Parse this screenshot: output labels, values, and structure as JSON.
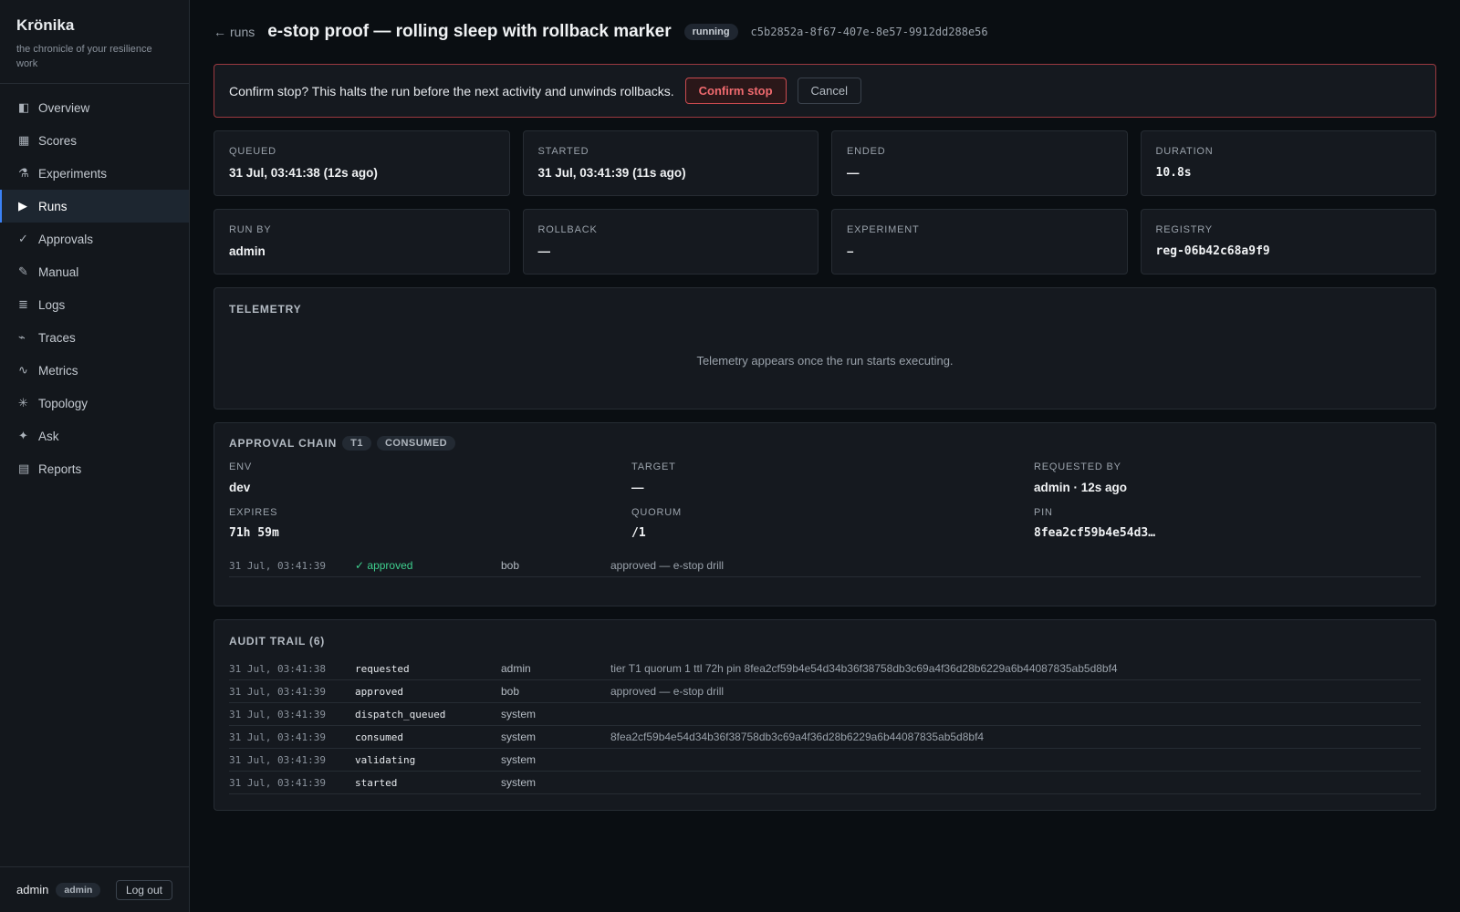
{
  "sidebar": {
    "brand": "Krönika",
    "tagline": "the chronicle of your resilience work",
    "items": [
      {
        "label": "Overview",
        "icon": "◧",
        "icon_name": "overview-icon"
      },
      {
        "label": "Scores",
        "icon": "▦",
        "icon_name": "scores-icon"
      },
      {
        "label": "Experiments",
        "icon": "⚗",
        "icon_name": "flask-icon"
      },
      {
        "label": "Runs",
        "icon": "▶",
        "icon_name": "play-icon"
      },
      {
        "label": "Approvals",
        "icon": "✓",
        "icon_name": "check-icon"
      },
      {
        "label": "Manual",
        "icon": "✎",
        "icon_name": "pencil-icon"
      },
      {
        "label": "Logs",
        "icon": "≣",
        "icon_name": "logs-icon"
      },
      {
        "label": "Traces",
        "icon": "⌁",
        "icon_name": "traces-icon"
      },
      {
        "label": "Metrics",
        "icon": "∿",
        "icon_name": "metrics-icon"
      },
      {
        "label": "Topology",
        "icon": "✳",
        "icon_name": "topology-icon"
      },
      {
        "label": "Ask",
        "icon": "✦",
        "icon_name": "sparkle-icon"
      },
      {
        "label": "Reports",
        "icon": "▤",
        "icon_name": "reports-icon"
      }
    ],
    "user": "admin",
    "role": "admin",
    "logout_label": "Log out"
  },
  "header": {
    "back_arrow": "←",
    "back_label": "runs",
    "title": "e-stop proof — rolling sleep with rollback marker",
    "status": "running",
    "run_id": "c5b2852a-8f67-407e-8e57-9912dd288e56"
  },
  "confirm": {
    "text": "Confirm stop? This halts the run before the next activity and unwinds rollbacks.",
    "confirm_label": "Confirm stop",
    "cancel_label": "Cancel"
  },
  "cards_row1": [
    {
      "label": "QUEUED",
      "value": "31 Jul, 03:41:38 (12s ago)"
    },
    {
      "label": "STARTED",
      "value": "31 Jul, 03:41:39 (11s ago)"
    },
    {
      "label": "ENDED",
      "value": "—"
    },
    {
      "label": "DURATION",
      "value": "10.8s"
    }
  ],
  "cards_row2": [
    {
      "label": "RUN BY",
      "value": "admin"
    },
    {
      "label": "ROLLBACK",
      "value": "—"
    },
    {
      "label": "EXPERIMENT",
      "value": "–"
    },
    {
      "label": "REGISTRY",
      "value": "reg-06b42c68a9f9"
    }
  ],
  "telemetry": {
    "title": "TELEMETRY",
    "empty_text": "Telemetry appears once the run starts executing."
  },
  "approval": {
    "title": "APPROVAL CHAIN",
    "tier": "T1",
    "state": "CONSUMED",
    "fields": [
      {
        "label": "ENV",
        "value": "dev"
      },
      {
        "label": "TARGET",
        "value": "—"
      },
      {
        "label": "REQUESTED BY",
        "value": "admin · 12s ago"
      },
      {
        "label": "EXPIRES",
        "value": "71h 59m"
      },
      {
        "label": "QUORUM",
        "value": "/1"
      },
      {
        "label": "PIN",
        "value": "8fea2cf59b4e54d3…"
      }
    ],
    "row": {
      "time": "31 Jul, 03:41:39",
      "status": "✓ approved",
      "actor": "bob",
      "note": "approved — e-stop drill"
    }
  },
  "audit": {
    "title": "AUDIT TRAIL (6)",
    "rows": [
      {
        "time": "31 Jul, 03:41:38",
        "event": "requested",
        "actor": "admin",
        "detail": "tier T1 quorum 1 ttl 72h pin 8fea2cf59b4e54d34b36f38758db3c69a4f36d28b6229a6b44087835ab5d8bf4"
      },
      {
        "time": "31 Jul, 03:41:39",
        "event": "approved",
        "actor": "bob",
        "detail": "approved — e-stop drill"
      },
      {
        "time": "31 Jul, 03:41:39",
        "event": "dispatch_queued",
        "actor": "system",
        "detail": ""
      },
      {
        "time": "31 Jul, 03:41:39",
        "event": "consumed",
        "actor": "system",
        "detail": "8fea2cf59b4e54d34b36f38758db3c69a4f36d28b6229a6b44087835ab5d8bf4"
      },
      {
        "time": "31 Jul, 03:41:39",
        "event": "validating",
        "actor": "system",
        "detail": ""
      },
      {
        "time": "31 Jul, 03:41:39",
        "event": "started",
        "actor": "system",
        "detail": ""
      }
    ]
  },
  "colors": {
    "accent": "#3b82f6",
    "danger": "#f06a6f",
    "success": "#3ecf8e",
    "background": "#0a0e12",
    "panel": "#15191f"
  }
}
